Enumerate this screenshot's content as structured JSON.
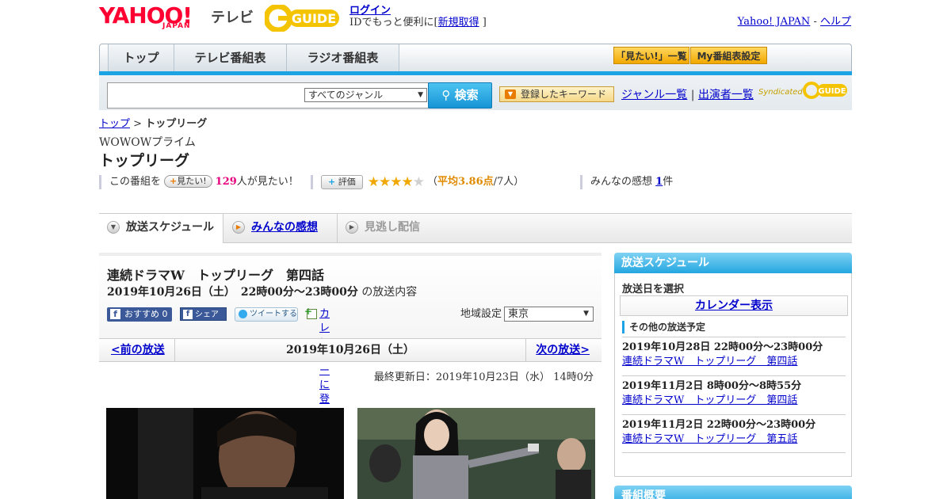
{
  "header": {
    "logo_yahoo": "YAHOO!",
    "logo_japan": "JAPAN",
    "logo_tv": "テレビ",
    "login": "ログイン",
    "login_sub_before": "IDでもっと便利に[",
    "register": "新規取得",
    "login_sub_after": "]",
    "yahoo_japan": "Yahoo! JAPAN",
    "dash": "-",
    "help": "ヘルプ"
  },
  "nav": {
    "tabs": [
      {
        "label": "トップ"
      },
      {
        "label": "テレビ番組表"
      },
      {
        "label": "ラジオ番組表"
      }
    ],
    "mitai_list": "「見たい!」一覧",
    "my_bangumi": "My番組表設定"
  },
  "search": {
    "placeholder": "",
    "genre": "すべてのジャンル",
    "button": "検索",
    "keyword_button": "登録したキーワード",
    "genre_list": "ジャンル一覧",
    "sep": "|",
    "performer_list": "出演者一覧",
    "syndicated": "Syndicated"
  },
  "breadcrumb": {
    "home": "トップ",
    "sep": ">",
    "current": "トップリーグ"
  },
  "program": {
    "channel": "WOWOWプライム",
    "title": "トップリーグ",
    "mitai_prefix": "この番組を",
    "mitai_badge": "見たい!",
    "mitai_count": "129",
    "mitai_suffix": "人が見たい！",
    "eval_badge": "評価",
    "rating": 3.86,
    "avg_open": "（",
    "avg_text": "平均3.86点",
    "avg_people": "/7人）",
    "kanso_prefix": "みんなの感想",
    "kanso_count": "1",
    "kanso_suffix": "件"
  },
  "tabs": {
    "schedule": "放送スケジュール",
    "kanso": "みんなの感想",
    "minogashi": "見逃し配信"
  },
  "episode": {
    "title": "連続ドラマW　トップリーグ　第四話",
    "date": "2019年10月26日（土）　22時00分～23時00分",
    "date_suffix": "の放送内容",
    "fb_recommend": "おすすめ 0",
    "fb_share": "シェア",
    "tweet": "ツイートする",
    "calendar": "カレンダーに登録",
    "region_label": "地域設定",
    "region": "東京"
  },
  "pager": {
    "prev": "<前の放送",
    "date": "2019年10月26日（土）",
    "next": "次の放送>",
    "updated": "最終更新日：2019年10月23日（水）  14時0分"
  },
  "sidebar": {
    "title": "放送スケジュール",
    "select_label": "放送日を選択",
    "calendar_btn": "カレンダー表示",
    "other_label": "その他の放送予定",
    "items": [
      {
        "when": "2019年10月28日  22時00分～23時00分",
        "what": "連続ドラマW　トップリーグ　第四話"
      },
      {
        "when": "2019年11月2日  8時00分～8時55分",
        "what": "連続ドラマW　トップリーグ　第四話"
      },
      {
        "when": "2019年11月2日  22時00分～23時00分",
        "what": "連続ドラマW　トップリーグ　第五話"
      }
    ],
    "title2": "番組概要"
  },
  "colors": {
    "accent_blue": "#1ba3e3",
    "yahoo_red": "#ff0033",
    "star": "#f0a800",
    "pink": "#e6007e"
  }
}
